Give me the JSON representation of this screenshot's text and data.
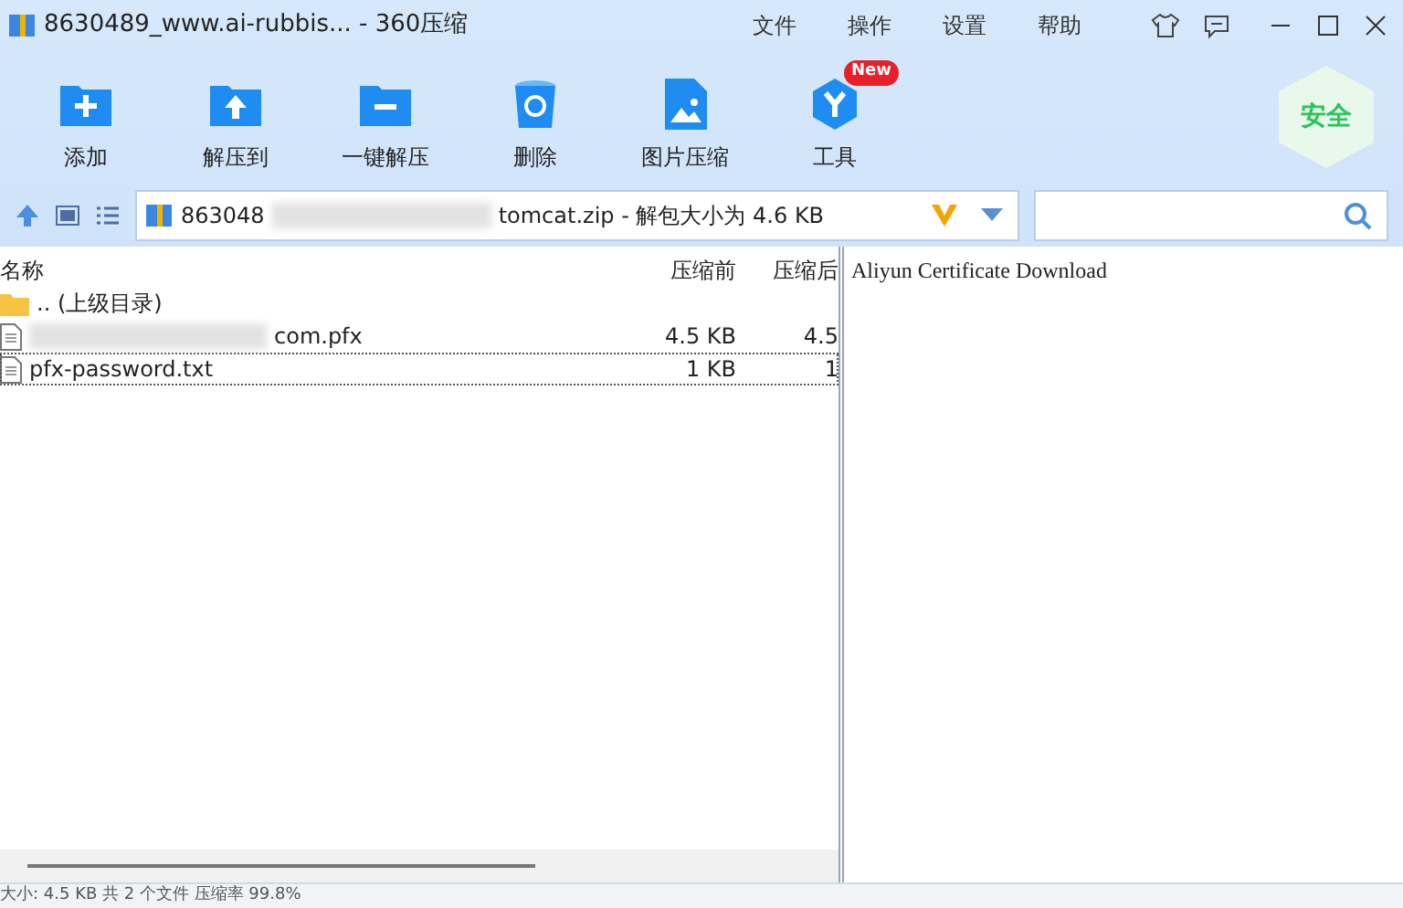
{
  "window": {
    "title": "8630489_www.ai-rubbis... - 360压缩"
  },
  "menu": [
    "文件",
    "操作",
    "设置",
    "帮助"
  ],
  "toolbar": [
    {
      "label": "添加",
      "kind": "add"
    },
    {
      "label": "解压到",
      "kind": "extract"
    },
    {
      "label": "一键解压",
      "kind": "oneclick"
    },
    {
      "label": "删除",
      "kind": "delete"
    },
    {
      "label": "图片压缩",
      "kind": "image"
    },
    {
      "label": "工具",
      "kind": "tools",
      "badge": "New"
    }
  ],
  "security_badge": "安全",
  "address": {
    "prefix": "863048",
    "suffix": "tomcat.zip - 解包大小为 4.6 KB"
  },
  "table": {
    "columns": [
      "名称",
      "压缩前",
      "压缩后"
    ],
    "rows": [
      {
        "kind": "parent",
        "name": ".. (上级目录)",
        "size": "",
        "packed": "",
        "focused": false
      },
      {
        "kind": "file",
        "name": "com.pfx",
        "blurred": true,
        "size": "4.5 KB",
        "packed": "4.5",
        "focused": false
      },
      {
        "kind": "file",
        "name": "pfx-password.txt",
        "blurred": false,
        "size": "1 KB",
        "packed": "1",
        "focused": true
      }
    ]
  },
  "preview": "Aliyun Certificate Download",
  "status_bar": "大小: 4.5 KB 共 2 个文件 压缩率 99.8%"
}
